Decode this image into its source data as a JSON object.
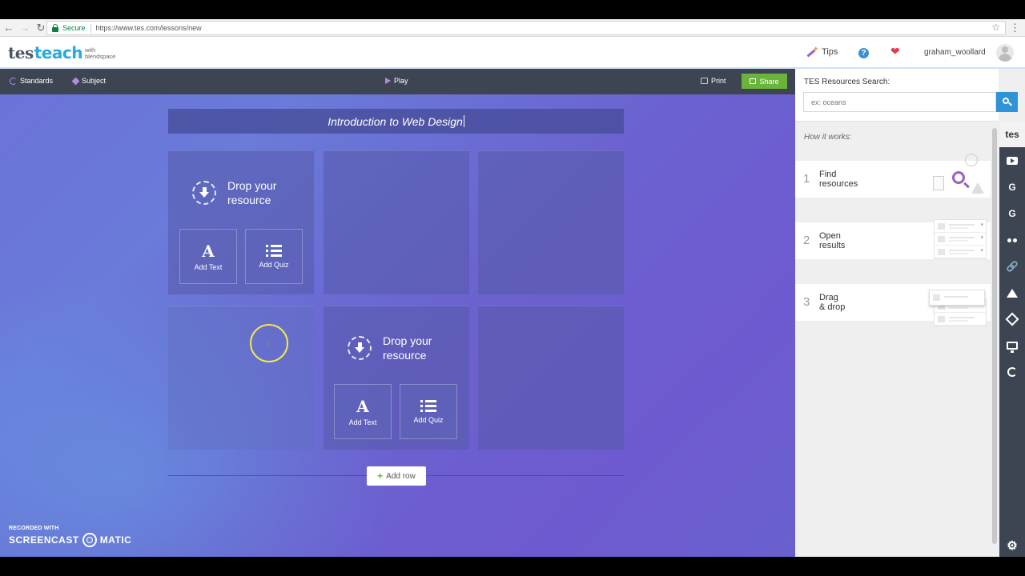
{
  "browser": {
    "secure_label": "Secure",
    "url": "https://www.tes.com/lessons/new"
  },
  "header": {
    "logo_tes": "tes",
    "logo_teach": "teach",
    "logo_with": "with",
    "logo_blendspace": "blendspace",
    "tips_label": "Tips",
    "username": "graham_woollard"
  },
  "toolbar": {
    "standards_label": "Standards",
    "subject_label": "Subject",
    "play_label": "Play",
    "print_label": "Print",
    "share_label": "Share"
  },
  "lesson": {
    "title": "Introduction to Web Design"
  },
  "tiles": {
    "drop_text": "Drop your resource",
    "add_text_label": "Add Text",
    "add_quiz_label": "Add Quiz"
  },
  "add_row_label": "Add row",
  "watermark": {
    "line1": "RECORDED WITH",
    "left": "SCREENCAST",
    "right": "MATIC"
  },
  "right_panel": {
    "search_label": "TES Resources Search:",
    "search_placeholder": "ex: oceans",
    "how_label": "How it works:",
    "steps": [
      {
        "num": "1",
        "text": "Find\nresources"
      },
      {
        "num": "2",
        "text": "Open\nresults"
      },
      {
        "num": "3",
        "text": "Drag\n& drop"
      }
    ],
    "rail_tes_label": "tes"
  },
  "colors": {
    "share_green": "#6bb43b",
    "search_blue": "#2f93d8",
    "toolbar_dark": "#3e4552",
    "accent_purple": "#9c5fc3"
  }
}
